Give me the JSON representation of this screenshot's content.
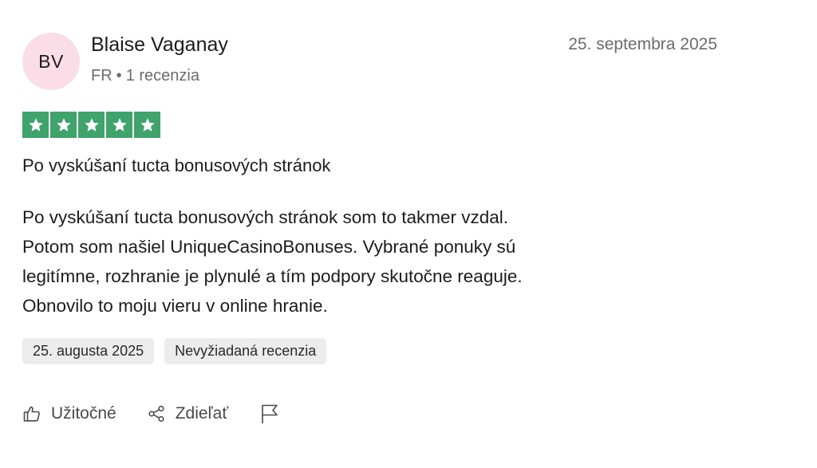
{
  "reviewer": {
    "initials": "BV",
    "name": "Blaise Vaganay",
    "country": "FR",
    "separator": "•",
    "review_count": "1 recenzia"
  },
  "review": {
    "posted_date": "25. septembra 2025",
    "rating": 5,
    "rating_max": 5,
    "star_color": "#3fa36c",
    "title": "Po vyskúšaní tucta bonusových stránok",
    "body_lines": [
      "Po vyskúšaní tucta bonusových stránok som to takmer vzdal.",
      "Potom som našiel UniqueCasinoBonuses. Vybrané ponuky sú",
      "legitímne, rozhranie je plynulé a tím podpory skutočne reaguje.",
      "Obnovilo to moju vieru v online hranie."
    ],
    "experience_date": "25. augusta 2025",
    "tag_label": "Nevyžiadaná recenzia"
  },
  "actions": {
    "helpful": {
      "label": "Užitočné",
      "icon": "thumbs-up-icon"
    },
    "share": {
      "label": "Zdieľať",
      "icon": "share-icon"
    },
    "report": {
      "icon": "flag-icon"
    }
  },
  "colors": {
    "avatar_bg": "#fadde6",
    "tag_bg": "#ececec",
    "muted_text": "#6b6b6b"
  }
}
